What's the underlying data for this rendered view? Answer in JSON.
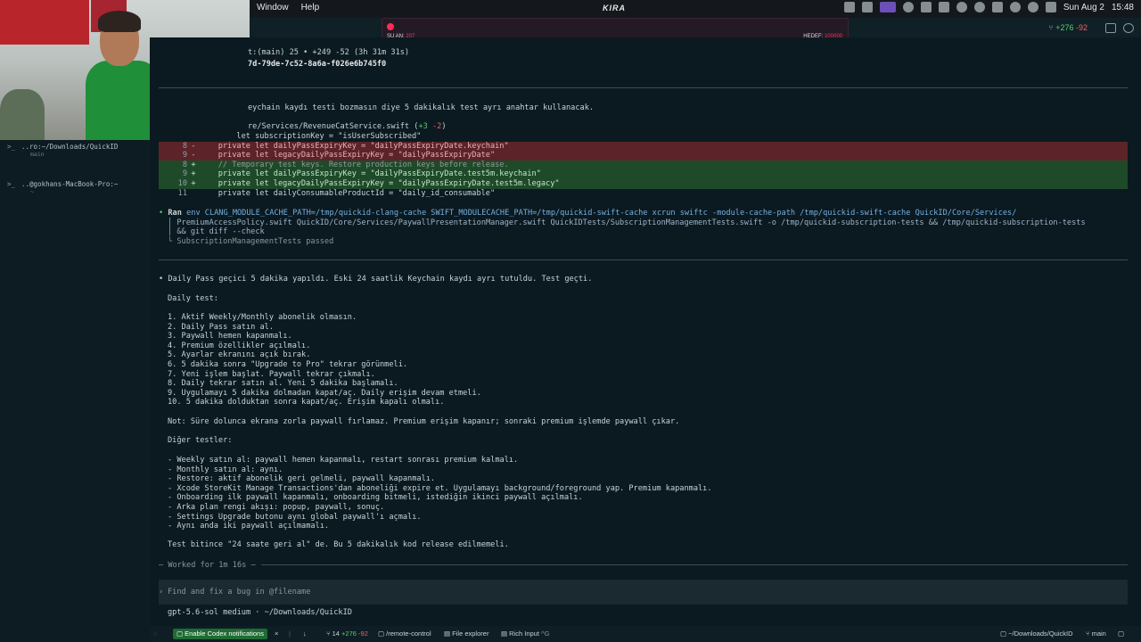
{
  "menubar": {
    "items": [
      "Window",
      "Help"
    ],
    "brand": "KIRA",
    "date": "Sun Aug 2",
    "time": "15:48"
  },
  "recorder": {
    "left_label": "ŞU AN:",
    "left_value": "207",
    "right_label": "HEDEF:",
    "right_value": "100000"
  },
  "titlestrip": {
    "additions": "+276",
    "deletions": "-92"
  },
  "sidebar": {
    "sessions": [
      {
        "label": "..ro:~/Downloads/QuickID",
        "sub": "main"
      },
      {
        "label": "..@gokhans-MacBook-Pro:~",
        "sub": "~"
      }
    ]
  },
  "terminal": {
    "header1": "t:(main) 25 • +249 -52 (3h 31m 31s)",
    "header2": "7d-79de-7c52-8a6a-f026e6b745f0",
    "note1": "eychain kaydı testi bozmasın diye 5 dakikalık test ayrı anahtar kullanacak.",
    "file_line": "re/Services/RevenueCatService.swift",
    "file_stats_open": " (",
    "file_add": "+3",
    "file_del": "-2",
    "file_stats_close": ")",
    "diff": [
      {
        "num": "",
        "sign": "",
        "kind": "ctx",
        "code": "let subscriptionKey = \"isUserSubscribed\""
      },
      {
        "num": "8",
        "sign": "-",
        "kind": "del",
        "code": "private let dailyPassExpiryKey = \"dailyPassExpiryDate.keychain\""
      },
      {
        "num": "9",
        "sign": "-",
        "kind": "del",
        "code": "private let legacyDailyPassExpiryKey = \"dailyPassExpiryDate\""
      },
      {
        "num": "8",
        "sign": "+",
        "kind": "add",
        "code": "// Temporary test keys. Restore production keys before release."
      },
      {
        "num": "9",
        "sign": "+",
        "kind": "add",
        "code": "private let dailyPassExpiryKey = \"dailyPassExpiryDate.test5m.keychain\""
      },
      {
        "num": "10",
        "sign": "+",
        "kind": "add",
        "code": "private let legacyDailyPassExpiryKey = \"dailyPassExpiryDate.test5m.legacy\""
      },
      {
        "num": "11",
        "sign": "",
        "kind": "ctx",
        "code": "private let dailyConsumableProductId = \"daily_id_consumable\""
      }
    ],
    "ran_label": "Ran",
    "ran_cmd1": "env CLANG_MODULE_CACHE_PATH=/tmp/quickid-clang-cache SWIFT_MODULECACHE_PATH=/tmp/quickid-swift-cache xcrun swiftc -module-cache-path /tmp/quickid-swift-cache QuickID/Core/Services/",
    "ran_cmd2": "PremiumAccessPolicy.swift QuickID/Core/Services/PaywallPresentationManager.swift QuickIDTests/SubscriptionManagementTests.swift -o /tmp/quickid-subscription-tests && /tmp/quickid-subscription-tests",
    "ran_cmd3": "&& git diff --check",
    "ran_result": "SubscriptionManagementTests passed",
    "summary": "Daily Pass geçici 5 dakika yapıldı. Eski 24 saatlik Keychain kaydı ayrı tutuldu. Test geçti.",
    "daily_title": "Daily test:",
    "daily_steps": [
      "1. Aktif Weekly/Monthly abonelik olmasın.",
      "2. Daily Pass satın al.",
      "3. Paywall hemen kapanmalı.",
      "4. Premium özellikler açılmalı.",
      "5. Ayarlar ekranını açık bırak.",
      "6. 5 dakika sonra \"Upgrade to Pro\" tekrar görünmeli.",
      "7. Yeni işlem başlat. Paywall tekrar çıkmalı.",
      "8. Daily tekrar satın al. Yeni 5 dakika başlamalı.",
      "9. Uygulamayı 5 dakika dolmadan kapat/aç. Daily erişim devam etmeli.",
      "10. 5 dakika dolduktan sonra kapat/aç. Erişim kapalı olmalı."
    ],
    "note2": "Not: Süre dolunca ekrana zorla paywall fırlamaz. Premium erişim kapanır; sonraki premium işlemde paywall çıkar.",
    "other_title": "Diğer testler:",
    "other_items": [
      "- Weekly satın al: paywall hemen kapanmalı, restart sonrası premium kalmalı.",
      "- Monthly satın al: aynı.",
      "- Restore: aktif abonelik geri gelmeli, paywall kapanmalı.",
      "- Xcode StoreKit Manage Transactions'dan aboneliği expire et. Uygulamayı background/foreground yap. Premium kapanmalı.",
      "- Onboarding ilk paywall kapanmalı, onboarding bitmeli, istediğin ikinci paywall açılmalı.",
      "- Arka plan rengi akışı: popup, paywall, sonuç.",
      "- Settings Upgrade butonu aynı global paywall'ı açmalı.",
      "- Aynı anda iki paywall açılmamalı."
    ],
    "final_note": "Test bitince \"24 saate geri al\" de. Bu 5 dakikalık kod release edilmemeli.",
    "worked": "— Worked for 1m 16s —",
    "prompt_placeholder": "Find and fix a bug in @filename",
    "model_line": "gpt-5.6-sol medium · ~/Downloads/QuickID"
  },
  "statusbar": {
    "notify": "Enable Codex notifications",
    "close": "×",
    "count": "14",
    "add": "+276",
    "del": "-92",
    "remote": "/remote-control",
    "explorer": "File explorer",
    "rich": "Rich Input",
    "rich_key": "^G",
    "path": "~/Downloads/QuickID",
    "branch": "main"
  },
  "colors": {
    "add": "#4fd06b",
    "del": "#ff5d5d",
    "accent": "#7b5bd6"
  }
}
